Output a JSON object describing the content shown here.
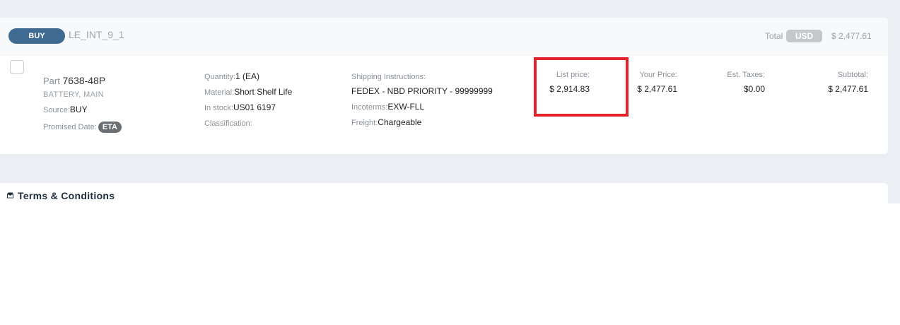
{
  "order": {
    "type_pill": "BUY",
    "id": "LE_INT_9_1",
    "total_label": "Total",
    "currency": "USD",
    "total_value": "$ 2,477.61"
  },
  "line_item": {
    "part_prefix": "Part",
    "part_number": "7638-48P",
    "description": "BATTERY, MAIN",
    "source_label": "Source:",
    "source_value": "BUY",
    "promised_label": "Promised Date:",
    "promised_badge": "ETA",
    "quantity_label": "Quantity:",
    "quantity_value": "1 (EA)",
    "material_label": "Material:",
    "material_value": "Short Shelf Life",
    "stock_label": "In stock:",
    "stock_value": "US01 6197",
    "classification_label": "Classification:",
    "shipping_label": "Shipping Instructions:",
    "shipping_value": "FEDEX - NBD PRIORITY - 99999999",
    "incoterms_label": "Incoterms:",
    "incoterms_value": "EXW-FLL",
    "freight_label": "Freight:",
    "freight_value": "Chargeable",
    "list_price_label": "List price:",
    "list_price_value": "$ 2,914.83",
    "your_price_label": "Your Price:",
    "your_price_value": "$ 2,477.61",
    "taxes_label": "Est. Taxes:",
    "taxes_value": "$0.00",
    "subtotal_label": "Subtotal:",
    "subtotal_value": "$ 2,477.61"
  },
  "terms": {
    "title": "Terms & Conditions",
    "icon": "inbox-icon"
  },
  "colors": {
    "background": "#ebeff3",
    "buy_pill": "#3f6a92",
    "highlight": "#e3222a",
    "usd_badge": "#c4c8cc",
    "eta_badge": "#6b6f73"
  }
}
